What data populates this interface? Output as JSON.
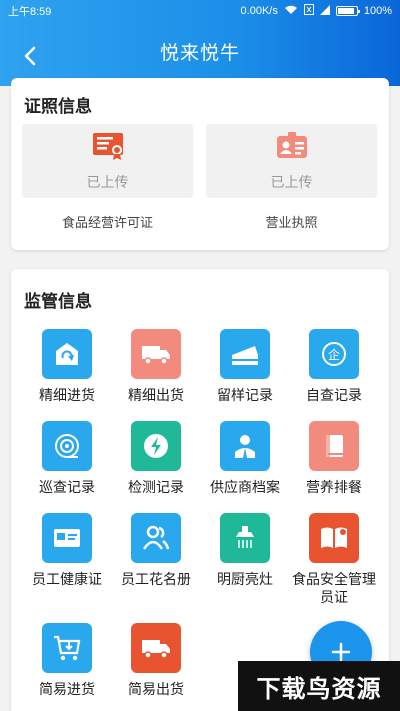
{
  "status": {
    "time": "上午8:59",
    "speed": "0.00K/s",
    "battery": "100%"
  },
  "header": {
    "title": "悦来悦牛"
  },
  "license": {
    "title": "证照信息",
    "items": [
      {
        "status": "已上传",
        "caption": "食品经营许可证",
        "icon": "certificate-icon"
      },
      {
        "status": "已上传",
        "caption": "营业执照",
        "icon": "id-card-icon"
      }
    ]
  },
  "supervise": {
    "title": "监管信息",
    "items": [
      {
        "label": "精细进货",
        "icon": "recycle-box-icon",
        "color": "#2aa8ee"
      },
      {
        "label": "精细出货",
        "icon": "truck-icon",
        "color": "#f28b7d"
      },
      {
        "label": "留样记录",
        "icon": "cake-icon",
        "color": "#2aa8ee"
      },
      {
        "label": "自查记录",
        "icon": "enterprise-icon",
        "color": "#2aa8ee"
      },
      {
        "label": "巡查记录",
        "icon": "patrol-icon",
        "color": "#2aa8ee"
      },
      {
        "label": "检测记录",
        "icon": "lightning-icon",
        "color": "#1fb99a"
      },
      {
        "label": "供应商档案",
        "icon": "supplier-person-icon",
        "color": "#2aa8ee"
      },
      {
        "label": "营养排餐",
        "icon": "book-icon",
        "color": "#f28b7d"
      },
      {
        "label": "员工健康证",
        "icon": "health-card-icon",
        "color": "#2aa8ee"
      },
      {
        "label": "员工花名册",
        "icon": "people-icon",
        "color": "#2aa8ee"
      },
      {
        "label": "明厨亮灶",
        "icon": "hood-icon",
        "color": "#1fb99a"
      },
      {
        "label": "食品安全管理员证",
        "icon": "open-book-icon",
        "color": "#e8542f"
      },
      {
        "label": "简易进货",
        "icon": "cart-icon",
        "color": "#2aa8ee"
      },
      {
        "label": "简易出货",
        "icon": "truck-icon",
        "color": "#e8542f"
      }
    ]
  },
  "fab": {
    "icon": "plus-icon"
  },
  "watermark": "下载鸟资源"
}
